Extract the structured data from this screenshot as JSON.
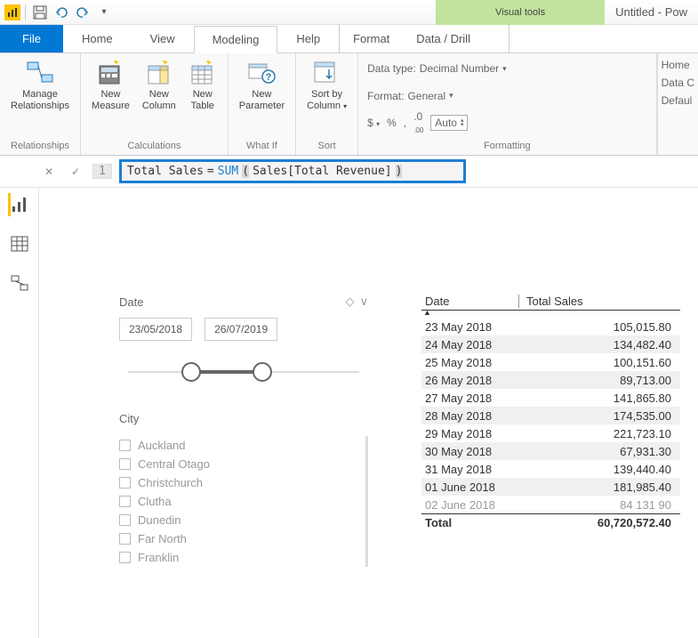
{
  "window": {
    "title": "Untitled - Pow"
  },
  "visual_tools": {
    "label": "Visual tools"
  },
  "tabs": {
    "file": "File",
    "home": "Home",
    "view": "View",
    "modeling": "Modeling",
    "help": "Help",
    "format": "Format",
    "data_drill": "Data / Drill"
  },
  "ribbon": {
    "manage_relationships": "Manage\nRelationships",
    "relationships_group": "Relationships",
    "new_measure": "New\nMeasure",
    "new_column": "New\nColumn",
    "new_table": "New\nTable",
    "calculations_group": "Calculations",
    "new_parameter": "New\nParameter",
    "whatif_group": "What If",
    "sort_by_column": "Sort by\nColumn",
    "sort_group": "Sort",
    "data_type_label": "Data type:",
    "data_type_value": "Decimal Number",
    "format_label": "Format:",
    "format_value": "General",
    "auto": "Auto",
    "formatting_group": "Formatting",
    "right_home": "Home",
    "right_data": "Data C",
    "right_default": "Defaul"
  },
  "formula": {
    "lineno": "1",
    "measure_name": "Total Sales",
    "equals": " = ",
    "func": "SUM",
    "open": "(",
    "arg": " Sales[Total Revenue] ",
    "close": ")"
  },
  "slicer": {
    "date_label": "Date",
    "date_from": "23/05/2018",
    "date_to": "26/07/2019",
    "city_label": "City",
    "cities": [
      "Auckland",
      "Central Otago",
      "Christchurch",
      "Clutha",
      "Dunedin",
      "Far North",
      "Franklin"
    ]
  },
  "table": {
    "col1": "Date",
    "col2": "Total Sales",
    "rows": [
      {
        "date": "23 May 2018",
        "sales": "105,015.80"
      },
      {
        "date": "24 May 2018",
        "sales": "134,482.40"
      },
      {
        "date": "25 May 2018",
        "sales": "100,151.60"
      },
      {
        "date": "26 May 2018",
        "sales": "89,713.00"
      },
      {
        "date": "27 May 2018",
        "sales": "141,865.80"
      },
      {
        "date": "28 May 2018",
        "sales": "174,535.00"
      },
      {
        "date": "29 May 2018",
        "sales": "221,723.10"
      },
      {
        "date": "30 May 2018",
        "sales": "67,931.30"
      },
      {
        "date": "31 May 2018",
        "sales": "139,440.40"
      },
      {
        "date": "01 June 2018",
        "sales": "181,985.40"
      },
      {
        "date": "02 June 2018",
        "sales": "84 131 90"
      }
    ],
    "total_label": "Total",
    "total_value": "60,720,572.40"
  }
}
